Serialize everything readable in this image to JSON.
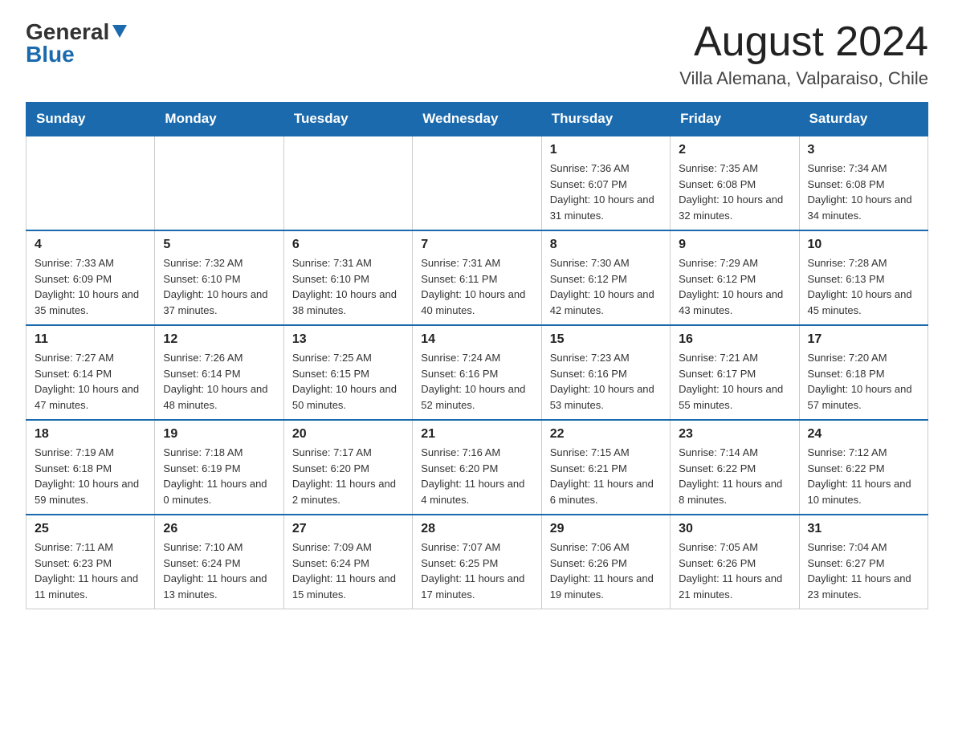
{
  "header": {
    "logo_general": "General",
    "logo_blue": "Blue",
    "month_title": "August 2024",
    "location": "Villa Alemana, Valparaiso, Chile"
  },
  "days_of_week": [
    "Sunday",
    "Monday",
    "Tuesday",
    "Wednesday",
    "Thursday",
    "Friday",
    "Saturday"
  ],
  "weeks": [
    [
      {
        "day": "",
        "info": ""
      },
      {
        "day": "",
        "info": ""
      },
      {
        "day": "",
        "info": ""
      },
      {
        "day": "",
        "info": ""
      },
      {
        "day": "1",
        "info": "Sunrise: 7:36 AM\nSunset: 6:07 PM\nDaylight: 10 hours and 31 minutes."
      },
      {
        "day": "2",
        "info": "Sunrise: 7:35 AM\nSunset: 6:08 PM\nDaylight: 10 hours and 32 minutes."
      },
      {
        "day": "3",
        "info": "Sunrise: 7:34 AM\nSunset: 6:08 PM\nDaylight: 10 hours and 34 minutes."
      }
    ],
    [
      {
        "day": "4",
        "info": "Sunrise: 7:33 AM\nSunset: 6:09 PM\nDaylight: 10 hours and 35 minutes."
      },
      {
        "day": "5",
        "info": "Sunrise: 7:32 AM\nSunset: 6:10 PM\nDaylight: 10 hours and 37 minutes."
      },
      {
        "day": "6",
        "info": "Sunrise: 7:31 AM\nSunset: 6:10 PM\nDaylight: 10 hours and 38 minutes."
      },
      {
        "day": "7",
        "info": "Sunrise: 7:31 AM\nSunset: 6:11 PM\nDaylight: 10 hours and 40 minutes."
      },
      {
        "day": "8",
        "info": "Sunrise: 7:30 AM\nSunset: 6:12 PM\nDaylight: 10 hours and 42 minutes."
      },
      {
        "day": "9",
        "info": "Sunrise: 7:29 AM\nSunset: 6:12 PM\nDaylight: 10 hours and 43 minutes."
      },
      {
        "day": "10",
        "info": "Sunrise: 7:28 AM\nSunset: 6:13 PM\nDaylight: 10 hours and 45 minutes."
      }
    ],
    [
      {
        "day": "11",
        "info": "Sunrise: 7:27 AM\nSunset: 6:14 PM\nDaylight: 10 hours and 47 minutes."
      },
      {
        "day": "12",
        "info": "Sunrise: 7:26 AM\nSunset: 6:14 PM\nDaylight: 10 hours and 48 minutes."
      },
      {
        "day": "13",
        "info": "Sunrise: 7:25 AM\nSunset: 6:15 PM\nDaylight: 10 hours and 50 minutes."
      },
      {
        "day": "14",
        "info": "Sunrise: 7:24 AM\nSunset: 6:16 PM\nDaylight: 10 hours and 52 minutes."
      },
      {
        "day": "15",
        "info": "Sunrise: 7:23 AM\nSunset: 6:16 PM\nDaylight: 10 hours and 53 minutes."
      },
      {
        "day": "16",
        "info": "Sunrise: 7:21 AM\nSunset: 6:17 PM\nDaylight: 10 hours and 55 minutes."
      },
      {
        "day": "17",
        "info": "Sunrise: 7:20 AM\nSunset: 6:18 PM\nDaylight: 10 hours and 57 minutes."
      }
    ],
    [
      {
        "day": "18",
        "info": "Sunrise: 7:19 AM\nSunset: 6:18 PM\nDaylight: 10 hours and 59 minutes."
      },
      {
        "day": "19",
        "info": "Sunrise: 7:18 AM\nSunset: 6:19 PM\nDaylight: 11 hours and 0 minutes."
      },
      {
        "day": "20",
        "info": "Sunrise: 7:17 AM\nSunset: 6:20 PM\nDaylight: 11 hours and 2 minutes."
      },
      {
        "day": "21",
        "info": "Sunrise: 7:16 AM\nSunset: 6:20 PM\nDaylight: 11 hours and 4 minutes."
      },
      {
        "day": "22",
        "info": "Sunrise: 7:15 AM\nSunset: 6:21 PM\nDaylight: 11 hours and 6 minutes."
      },
      {
        "day": "23",
        "info": "Sunrise: 7:14 AM\nSunset: 6:22 PM\nDaylight: 11 hours and 8 minutes."
      },
      {
        "day": "24",
        "info": "Sunrise: 7:12 AM\nSunset: 6:22 PM\nDaylight: 11 hours and 10 minutes."
      }
    ],
    [
      {
        "day": "25",
        "info": "Sunrise: 7:11 AM\nSunset: 6:23 PM\nDaylight: 11 hours and 11 minutes."
      },
      {
        "day": "26",
        "info": "Sunrise: 7:10 AM\nSunset: 6:24 PM\nDaylight: 11 hours and 13 minutes."
      },
      {
        "day": "27",
        "info": "Sunrise: 7:09 AM\nSunset: 6:24 PM\nDaylight: 11 hours and 15 minutes."
      },
      {
        "day": "28",
        "info": "Sunrise: 7:07 AM\nSunset: 6:25 PM\nDaylight: 11 hours and 17 minutes."
      },
      {
        "day": "29",
        "info": "Sunrise: 7:06 AM\nSunset: 6:26 PM\nDaylight: 11 hours and 19 minutes."
      },
      {
        "day": "30",
        "info": "Sunrise: 7:05 AM\nSunset: 6:26 PM\nDaylight: 11 hours and 21 minutes."
      },
      {
        "day": "31",
        "info": "Sunrise: 7:04 AM\nSunset: 6:27 PM\nDaylight: 11 hours and 23 minutes."
      }
    ]
  ]
}
